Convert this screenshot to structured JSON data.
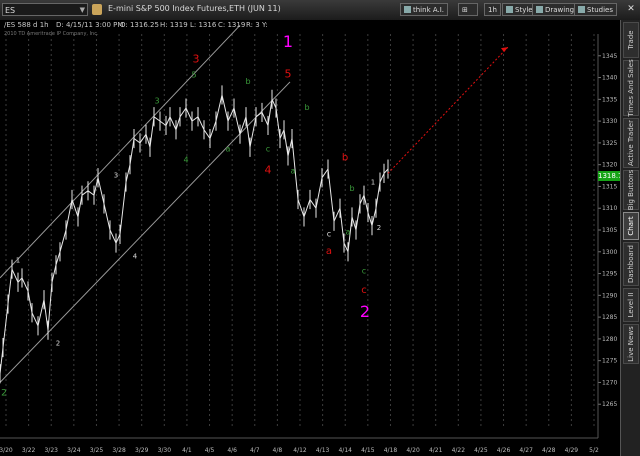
{
  "toolbar": {
    "symbol": "ES",
    "description": "E-mini S&P 500 Index Futures,ETH (JUN 11)",
    "think_label": "think A.I.",
    "period_label": "1h",
    "style_label": "Style",
    "drawings_label": "Drawings",
    "studies_label": "Studies"
  },
  "info": {
    "symbol": "/ES 588 d 1h",
    "date": "D: 4/15/11 3:00 PM",
    "open": "O: 1316.25",
    "high": "H: 1319",
    "low": "L: 1316",
    "close": "C: 1319",
    "range": "R: 3",
    "y": "Y:",
    "copyright": "2010 TD Ameritrade IP Company, Inc."
  },
  "last_price": "1318.75",
  "sidebar_tabs": [
    "Trade",
    "Times And Sales",
    "Active Trader",
    "Big Buttons",
    "Chart",
    "Dashboard",
    "Level II",
    "Live News"
  ],
  "sidebar_active": "Chart",
  "colors": {
    "background": "#000000",
    "price": "#e8e8e8",
    "red_wave": "#e01010",
    "green_wave": "#3a9a3a",
    "magenta_wave": "#ff00ff",
    "last_price": "#16a316"
  },
  "chart_data": {
    "type": "line",
    "timeframe": "1h",
    "ylim": [
      1260,
      1350
    ],
    "y_ticks": [
      1265,
      1270,
      1275,
      1280,
      1285,
      1290,
      1295,
      1300,
      1305,
      1310,
      1315,
      1320,
      1325,
      1330,
      1335,
      1340,
      1345
    ],
    "x_ticks": [
      "3/20",
      "3/22",
      "3/23",
      "3/24",
      "3/25",
      "3/28",
      "3/29",
      "3/30",
      "4/1",
      "4/5",
      "4/6",
      "4/7",
      "4/8",
      "4/12",
      "4/13",
      "4/14",
      "4/15",
      "4/18",
      "4/20",
      "4/21",
      "4/22",
      "4/25",
      "4/26",
      "4/27",
      "4/28",
      "4/29",
      "5/2"
    ],
    "series": [
      {
        "x": [
          0,
          3,
          8,
          12,
          18,
          22,
          28,
          32,
          38,
          44,
          48,
          52,
          56,
          60,
          66,
          72,
          78,
          82,
          88,
          94,
          98,
          104,
          110,
          116,
          120,
          126,
          130,
          134,
          140,
          146,
          150,
          154,
          160,
          166,
          170,
          176,
          180,
          186,
          192,
          198,
          204,
          210,
          216,
          222,
          228,
          234,
          240,
          246,
          250,
          256,
          262,
          268,
          272,
          276,
          280,
          284,
          288,
          292,
          298,
          304,
          310,
          316,
          322,
          328,
          334,
          340,
          344,
          348,
          352,
          356,
          360,
          364,
          368,
          372,
          376,
          380,
          384,
          388
        ],
        "close": [
          1272,
          1278,
          1288,
          1296,
          1293,
          1294,
          1291,
          1286,
          1283,
          1289,
          1282,
          1293,
          1297,
          1300,
          1305,
          1312,
          1308,
          1313,
          1314,
          1313,
          1317,
          1311,
          1305,
          1302,
          1304,
          1316,
          1320,
          1326,
          1325,
          1327,
          1324,
          1331,
          1330,
          1329,
          1331,
          1328,
          1331,
          1333,
          1330,
          1331,
          1328,
          1326,
          1330,
          1336,
          1330,
          1333,
          1327,
          1331,
          1324,
          1331,
          1332,
          1329,
          1335,
          1333,
          1326,
          1328,
          1322,
          1326,
          1312,
          1308,
          1312,
          1310,
          1317,
          1319,
          1307,
          1310,
          1302,
          1300,
          1308,
          1305,
          1311,
          1313,
          1309,
          1306,
          1310,
          1316,
          1318,
          1319
        ]
      }
    ],
    "channel": [
      {
        "x1": 0,
        "y1": 1294,
        "x2": 240,
        "y2": 1352
      },
      {
        "x1": 0,
        "y1": 1270,
        "x2": 290,
        "y2": 1339
      }
    ],
    "projection": {
      "x1": 388,
      "y1": 1318,
      "x2": 508,
      "y2": 1347
    },
    "annotations": [
      {
        "text": "2",
        "x": 4,
        "y": 1267,
        "color": "#3a9a3a",
        "size": 9
      },
      {
        "text": "1",
        "x": 18,
        "y": 1297.5,
        "color": "#d8d8d8",
        "size": 7
      },
      {
        "text": "2",
        "x": 58,
        "y": 1278.5,
        "color": "#d8d8d8",
        "size": 7
      },
      {
        "text": "3",
        "x": 116,
        "y": 1317,
        "color": "#d8d8d8",
        "size": 7
      },
      {
        "text": "4",
        "x": 135,
        "y": 1298.5,
        "color": "#d8d8d8",
        "size": 7
      },
      {
        "text": "3",
        "x": 157,
        "y": 1334,
        "color": "#3a9a3a",
        "size": 8
      },
      {
        "text": "4",
        "x": 186,
        "y": 1320.5,
        "color": "#3a9a3a",
        "size": 8
      },
      {
        "text": "5",
        "x": 194,
        "y": 1340,
        "color": "#3a9a3a",
        "size": 8
      },
      {
        "text": "3",
        "x": 196,
        "y": 1343.5,
        "color": "#e01010",
        "size": 11
      },
      {
        "text": "a",
        "x": 228,
        "y": 1323,
        "color": "#3a9a3a",
        "size": 8
      },
      {
        "text": "b",
        "x": 248,
        "y": 1338.5,
        "color": "#3a9a3a",
        "size": 8
      },
      {
        "text": "c",
        "x": 268,
        "y": 1323,
        "color": "#3a9a3a",
        "size": 8
      },
      {
        "text": "4",
        "x": 268,
        "y": 1318,
        "color": "#e01010",
        "size": 11
      },
      {
        "text": "1",
        "x": 288,
        "y": 1347,
        "color": "#ff00ff",
        "size": 16
      },
      {
        "text": "5",
        "x": 288,
        "y": 1340,
        "color": "#e01010",
        "size": 11
      },
      {
        "text": "b",
        "x": 307,
        "y": 1332.5,
        "color": "#3a9a3a",
        "size": 8
      },
      {
        "text": "a",
        "x": 293,
        "y": 1318,
        "color": "#3a9a3a",
        "size": 8
      },
      {
        "text": "c",
        "x": 329,
        "y": 1303.5,
        "color": "#d8d8d8",
        "size": 8
      },
      {
        "text": "a",
        "x": 329,
        "y": 1299.5,
        "color": "#e01010",
        "size": 10
      },
      {
        "text": "b",
        "x": 345,
        "y": 1321,
        "color": "#e01010",
        "size": 10
      },
      {
        "text": "b",
        "x": 352,
        "y": 1314,
        "color": "#3a9a3a",
        "size": 8
      },
      {
        "text": "a",
        "x": 348,
        "y": 1304,
        "color": "#3a9a3a",
        "size": 8
      },
      {
        "text": "c",
        "x": 364,
        "y": 1295,
        "color": "#3a9a3a",
        "size": 8
      },
      {
        "text": "c",
        "x": 364,
        "y": 1290.5,
        "color": "#e01010",
        "size": 10
      },
      {
        "text": "2",
        "x": 365,
        "y": 1285,
        "color": "#ff00ff",
        "size": 16
      },
      {
        "text": "1",
        "x": 373,
        "y": 1315.5,
        "color": "#d8d8d8",
        "size": 7
      },
      {
        "text": "2",
        "x": 379,
        "y": 1305,
        "color": "#d8d8d8",
        "size": 7
      }
    ]
  }
}
